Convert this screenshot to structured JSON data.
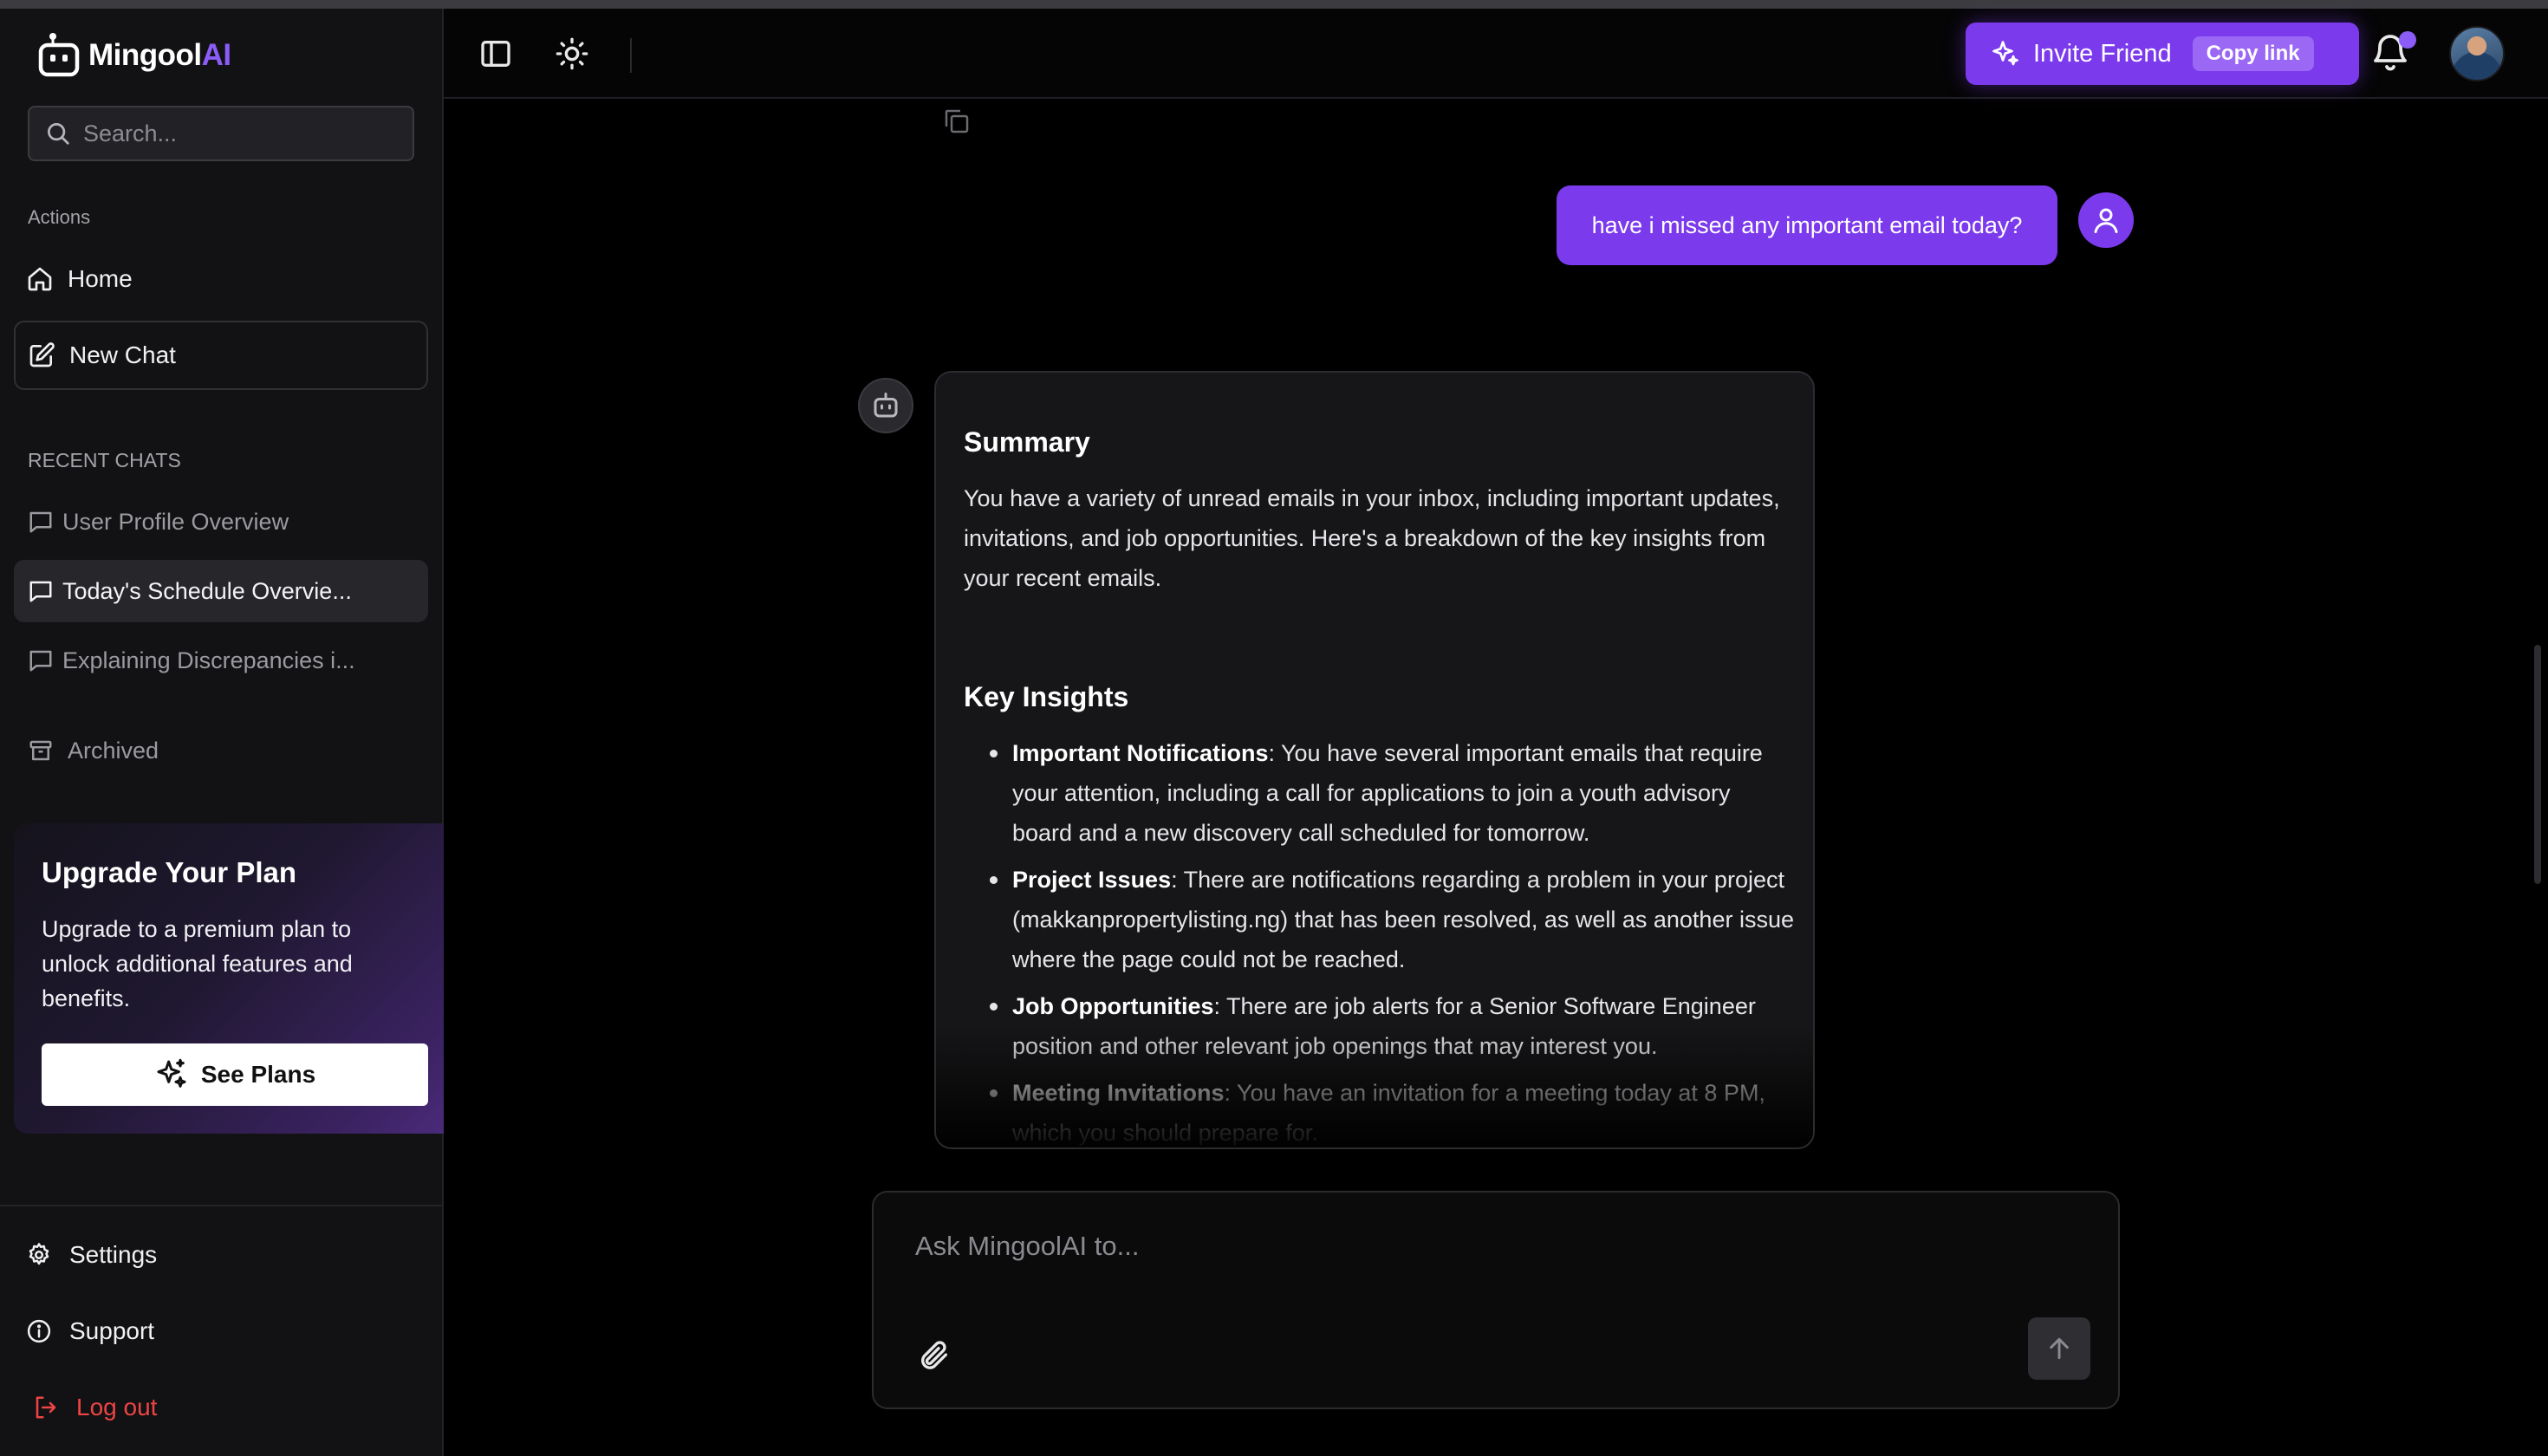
{
  "app": {
    "brand_main": "Mingool",
    "brand_accent": "AI",
    "accent_color": "#7c3aed",
    "danger_color": "#ef4444"
  },
  "sidebar": {
    "search_placeholder": "Search...",
    "actions_label": "Actions",
    "actions": [
      {
        "label": "Home",
        "icon": "home-icon"
      },
      {
        "label": "New Chat",
        "icon": "edit-icon"
      }
    ],
    "recent_label": "RECENT CHATS",
    "recent_chats": [
      {
        "label": "User Profile Overview",
        "active": false
      },
      {
        "label": "Today's Schedule Overvie...",
        "active": true
      },
      {
        "label": "Explaining Discrepancies i...",
        "active": false
      }
    ],
    "archived_label": "Archived",
    "upgrade": {
      "title": "Upgrade Your Plan",
      "text": "Upgrade to a premium plan to unlock additional features and benefits.",
      "button_label": "See Plans"
    },
    "footer": [
      {
        "label": "Settings",
        "icon": "gear-icon"
      },
      {
        "label": "Support",
        "icon": "info-icon"
      },
      {
        "label": "Log out",
        "icon": "logout-icon"
      }
    ]
  },
  "topbar": {
    "invite_label": "Invite Friend",
    "copy_link_label": "Copy link",
    "has_notification": true
  },
  "conversation": {
    "user_message": "have i missed any important email today?",
    "assistant": {
      "summary_heading": "Summary",
      "summary_text": "You have a variety of unread emails in your inbox, including important updates, invitations, and job opportunities. Here's a breakdown of the key insights from your recent emails.",
      "insights_heading": "Key Insights",
      "insights": [
        {
          "title": "Important Notifications",
          "text": ": You have several important emails that require your attention, including a call for applications to join a youth advisory board and a new discovery call scheduled for tomorrow."
        },
        {
          "title": "Project Issues",
          "text": ": There are notifications regarding a problem in your project (makkanpropertylisting.ng) that has been resolved, as well as another issue where the page could not be reached."
        },
        {
          "title": "Job Opportunities",
          "text": ": There are job alerts for a Senior Software Engineer position and other relevant job openings that may interest you."
        },
        {
          "title": "Meeting Invitations",
          "text": ": You have an invitation for a meeting today at 8 PM, which you should prepare for."
        }
      ]
    }
  },
  "composer": {
    "placeholder": "Ask MingoolAI to..."
  }
}
